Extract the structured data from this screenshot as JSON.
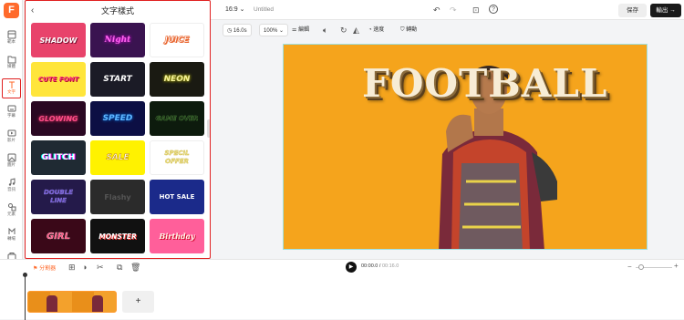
{
  "app": {
    "logo": "F"
  },
  "rail": [
    {
      "label": "範本",
      "icon": "template-icon"
    },
    {
      "label": "媒體",
      "icon": "media-icon"
    },
    {
      "label": "文字",
      "icon": "text-icon"
    },
    {
      "label": "字幕",
      "icon": "subtitle-icon"
    },
    {
      "label": "影片",
      "icon": "video-icon"
    },
    {
      "label": "圖片",
      "icon": "image-icon"
    },
    {
      "label": "音訊",
      "icon": "audio-icon"
    },
    {
      "label": "元素",
      "icon": "elements-icon"
    },
    {
      "label": "轉場",
      "icon": "transition-icon"
    },
    {
      "label": "工具",
      "icon": "tools-icon"
    }
  ],
  "panel": {
    "title": "文字樣式",
    "tiles": [
      "SHADOW",
      "Night",
      "JUICE",
      "CUTE FONT",
      "START",
      "NEON",
      "GLOWING",
      "SPEED",
      "GAME OVER",
      "GLITCH",
      "SALE",
      "SPECIL OFFER",
      "DOUBLE LINE",
      "Flashy",
      "HOT SALE",
      "GIRL",
      "MONSTER",
      "Birthday"
    ]
  },
  "topbar": {
    "ratio": "16:9",
    "title": "Untitled",
    "save": "保存",
    "export": "輸出"
  },
  "toolbar": {
    "duration": "16.0s",
    "zoom": "100%",
    "edit": "編輯",
    "speed": "速度",
    "flip": "轉動"
  },
  "canvas": {
    "headline": "FOOTBALL"
  },
  "timeline": {
    "split_label": "分割器",
    "current": "00:00.0",
    "total": "00:16.0",
    "add": "+"
  },
  "colors": {
    "accent": "#ff6a2b",
    "export_bg": "#1a1a1a",
    "canvas_bg": "#f5a41c"
  }
}
